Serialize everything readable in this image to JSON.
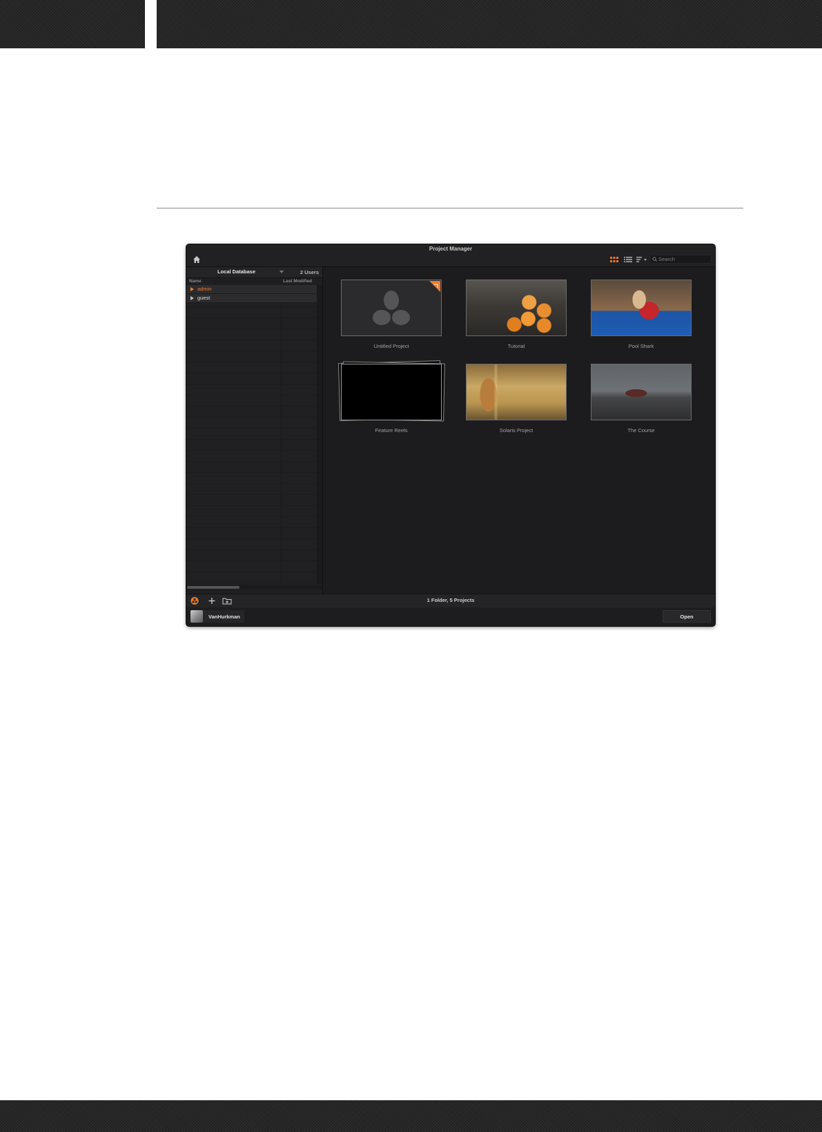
{
  "window": {
    "title": "Project Manager"
  },
  "toolbar": {
    "search_placeholder": "Search"
  },
  "database": {
    "name": "Local Database",
    "users_count": "2 Users"
  },
  "user_list": {
    "columns": [
      "Name",
      "Last Modified"
    ],
    "users": [
      {
        "name": "admin",
        "active": true
      },
      {
        "name": "guest",
        "active": false
      }
    ]
  },
  "projects": [
    {
      "name": "Untitled Project"
    },
    {
      "name": "Tutorial"
    },
    {
      "name": "Pool Shark"
    },
    {
      "name": "Feature Reels"
    },
    {
      "name": "Solaris Project"
    },
    {
      "name": "The Course"
    }
  ],
  "status": {
    "text": "1 Folder, 5 Projects"
  },
  "bottom": {
    "username": "VanHurkman",
    "open_label": "Open"
  },
  "colors": {
    "accent": "#f07a2a",
    "window_bg": "#1c1c1e",
    "panel_bg": "#1f1f21"
  },
  "icons": {
    "home": "home-icon",
    "grid": "grid-view-icon",
    "list": "list-view-icon",
    "sort": "sort-icon",
    "search": "search-icon",
    "settings": "settings-icon",
    "add": "plus-icon",
    "folder": "folder-icon",
    "logo": "resolve-logo-icon"
  }
}
